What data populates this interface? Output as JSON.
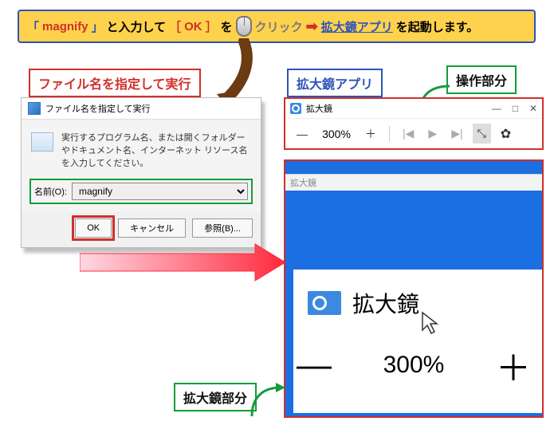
{
  "instruction": {
    "open_bracket": "「",
    "command": "magnify",
    "close_bracket": "」",
    "type_text": "と入力して",
    "ok_open": "［",
    "ok_label": "OK",
    "ok_close": "］",
    "wo": "を",
    "click_text": "クリック",
    "arrow": "➡",
    "app_link": "拡大鏡アプリ",
    "launch_text": "を起動します。"
  },
  "labels": {
    "run_dialog": "ファイル名を指定して実行",
    "magnifier_app": "拡大鏡アプリ",
    "control_part": "操作部分",
    "zoom_part": "拡大鏡部分"
  },
  "run_dialog": {
    "title": "ファイル名を指定して実行",
    "description": "実行するプログラム名、または開くフォルダーやドキュメント名、インターネット リソース名を入力してください。",
    "name_label": "名前(O):",
    "input_value": "magnify",
    "ok": "OK",
    "cancel": "キャンセル",
    "browse": "参照(B)..."
  },
  "magnifier_bar": {
    "title": "拡大鏡",
    "minus": "—",
    "zoom_value": "300%",
    "plus": "＋",
    "prev_skip": "|◀",
    "play": "▶",
    "next_skip": "▶|",
    "cursor_mode": "⤡",
    "gear": "✿",
    "win_min": "—",
    "win_max": "□",
    "win_close": "✕"
  },
  "mag_zoom": {
    "titlebar": "拡大鏡",
    "label": "拡大鏡",
    "cursor": "↖",
    "minus": "—",
    "pct": "300%",
    "plus": "＋"
  }
}
